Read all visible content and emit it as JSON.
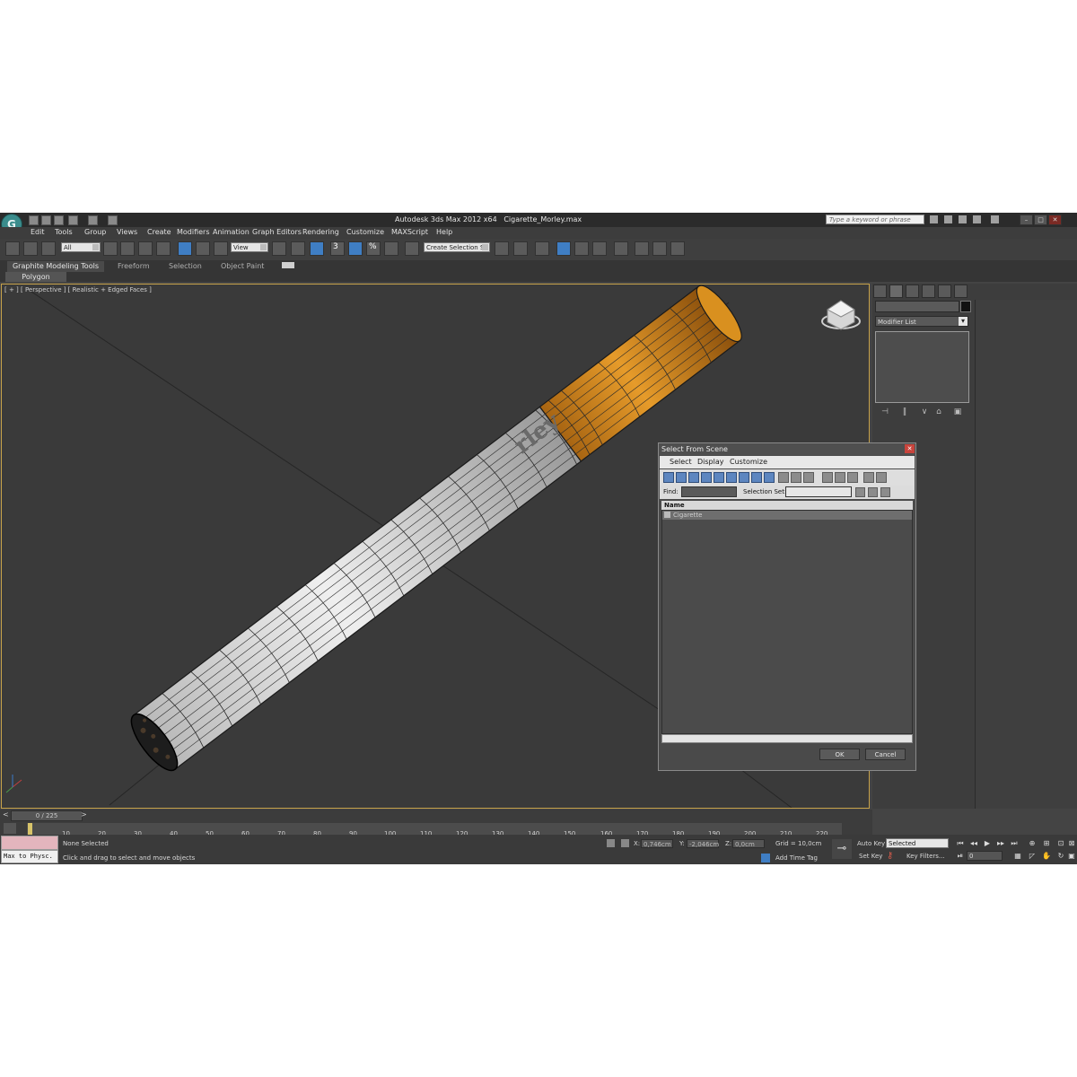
{
  "window": {
    "app_title": "Autodesk 3ds Max  2012 x64",
    "file_name": "Cigarette_Morley.max",
    "search_placeholder": "Type a keyword or phrase",
    "logo_letter": "G"
  },
  "menus": [
    "Edit",
    "Tools",
    "Group",
    "Views",
    "Create",
    "Modifiers",
    "Animation",
    "Graph Editors",
    "Rendering",
    "Customize",
    "MAXScript",
    "Help"
  ],
  "toolbar": {
    "filter_value": "All",
    "ref_coord_value": "View",
    "selection_set_placeholder": "Create Selection Se",
    "snap_label": "3",
    "percent_label": "%"
  },
  "ribbon": {
    "tabs": [
      "Graphite Modeling Tools",
      "Freeform",
      "Selection",
      "Object Paint"
    ],
    "panel_label": "Polygon Modeling"
  },
  "viewport": {
    "label": "[ + ] [ Perspective ] [ Realistic + Edged Faces ]",
    "brand_text": "rley"
  },
  "command_panel": {
    "modifier_list": "Modifier List"
  },
  "dialog": {
    "title": "Select From Scene",
    "menus": [
      "Select",
      "Display",
      "Customize"
    ],
    "find_label": "Find:",
    "selection_set_label": "Selection Set:",
    "column_name": "Name",
    "rows": [
      "Cigarette"
    ],
    "ok_label": "OK",
    "cancel_label": "Cancel"
  },
  "timeline": {
    "frame_readout": "0 / 225",
    "ticks": [
      "10",
      "20",
      "30",
      "40",
      "50",
      "60",
      "70",
      "80",
      "90",
      "100",
      "110",
      "120",
      "130",
      "140",
      "150",
      "160",
      "170",
      "180",
      "190",
      "200",
      "210",
      "220"
    ]
  },
  "status": {
    "maxscript_text": "Max to Physc.",
    "selection_status": "None Selected",
    "prompt": "Click and drag to select and move objects",
    "x_label": "X:",
    "x_value": "0,746cm",
    "y_label": "Y:",
    "y_value": "-2,046cm",
    "z_label": "Z:",
    "z_value": "0,0cm",
    "grid": "Grid = 10,0cm",
    "add_time_tag": "Add Time Tag",
    "auto_key": "Auto Key",
    "set_key": "Set Key",
    "key_mode_value": "Selected",
    "key_filters": "Key Filters...",
    "current_frame": "0"
  },
  "colors": {
    "viewport_border": "#c7a24a",
    "filter_orange": "#d98b1e",
    "paper_white": "#f2f2f2",
    "active_blue": "#3f7ec4"
  }
}
